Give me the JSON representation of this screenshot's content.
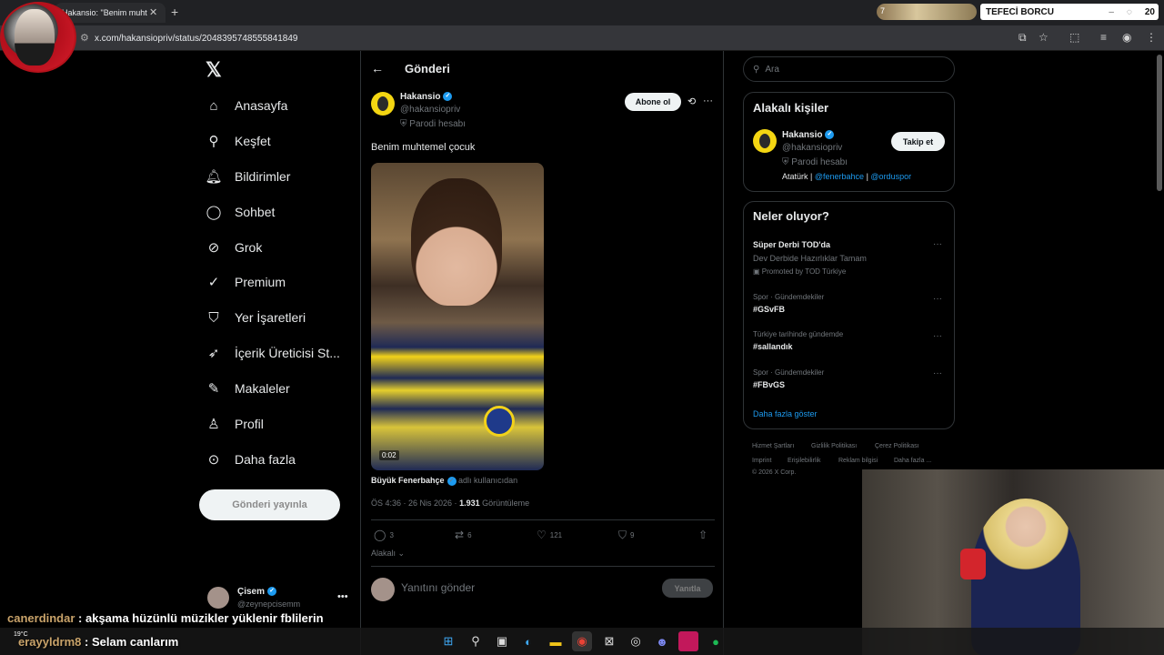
{
  "browser": {
    "tab_title": "Hakansio: \"Benim muht",
    "url": "x.com/hakansiopriv/status/2048395748555841849",
    "game_counter": "7",
    "ext_title": "TEFECİ BORCU",
    "ext_value": "20"
  },
  "nav": {
    "items": [
      {
        "label": "Anasayfa",
        "icon": "home-icon"
      },
      {
        "label": "Keşfet",
        "icon": "search-icon"
      },
      {
        "label": "Bildirimler",
        "icon": "bell-icon"
      },
      {
        "label": "Sohbet",
        "icon": "chat-icon"
      },
      {
        "label": "Grok",
        "icon": "grok-icon"
      },
      {
        "label": "Premium",
        "icon": "premium-icon"
      },
      {
        "label": "Yer İşaretleri",
        "icon": "bookmark-icon"
      },
      {
        "label": "İçerik Üreticisi St...",
        "icon": "rocket-icon"
      },
      {
        "label": "Makaleler",
        "icon": "article-icon"
      },
      {
        "label": "Profil",
        "icon": "person-icon"
      },
      {
        "label": "Daha fazla",
        "icon": "more-circle-icon"
      }
    ],
    "post_button": "Gönderi yayınla",
    "me_name": "Çisem",
    "me_handle": "@zeynepcisemm"
  },
  "main": {
    "title": "Gönderi",
    "author_name": "Hakansio",
    "author_handle": "@hakansiopriv",
    "parody": "Parodi hesabı",
    "follow": "Abone ol",
    "text": "Benim muhtemel çocuk",
    "video_time": "0:02",
    "source_name": "Büyük Fenerbahçe",
    "source_suffix": "adlı kullanıcıdan",
    "time": "ÖS 4:36 · 26 Nis 2026 ·",
    "views_count": "1.931",
    "views_label": "Görüntüleme",
    "actions": {
      "replies": "3",
      "reposts": "6",
      "likes": "121",
      "bookmarks": "9"
    },
    "relevance": "Alakalı",
    "reply_placeholder": "Yanıtını gönder",
    "reply_button": "Yanıtla"
  },
  "right": {
    "search_placeholder": "Ara",
    "related_title": "Alakalı kişiler",
    "related_name": "Hakansio",
    "related_handle": "@hakansiopriv",
    "related_parody": "Parodi hesabı",
    "follow_button": "Takip et",
    "bio_text": "Atatürk |",
    "bio_link1": "@fenerbahce",
    "bio_sep": "|",
    "bio_link2": "@orduspor",
    "trends_title": "Neler oluyor?",
    "trends": [
      {
        "name": "Süper Derbi TOD'da",
        "sub": "Dev Derbide Hazırlıklar Tamam",
        "promo": "Promoted by TOD Türkiye"
      },
      {
        "cat": "Spor · Gündemdekiler",
        "name": "#GSvFB"
      },
      {
        "cat": "Türkiye tarihinde gündemde",
        "name": "#sallandık"
      },
      {
        "cat": "Spor · Gündemdekiler",
        "name": "#FBvGS"
      }
    ],
    "show_more": "Daha fazla göster",
    "footer": [
      "Hizmet Şartları",
      "Gizlilik Politikası",
      "Çerez Politikası",
      "Imprint",
      "Erişilebilirlik",
      "Reklam bilgisi",
      "Daha fazla ...",
      "© 2026 X Corp."
    ]
  },
  "overlay": {
    "chat": [
      {
        "user": "canerdindar",
        "msg": ": akşama hüzünlü müzikler yüklenir fblilerin"
      },
      {
        "user": "erayyldrm8",
        "msg": ": Selam canlarım"
      }
    ],
    "weather": "19°C"
  }
}
